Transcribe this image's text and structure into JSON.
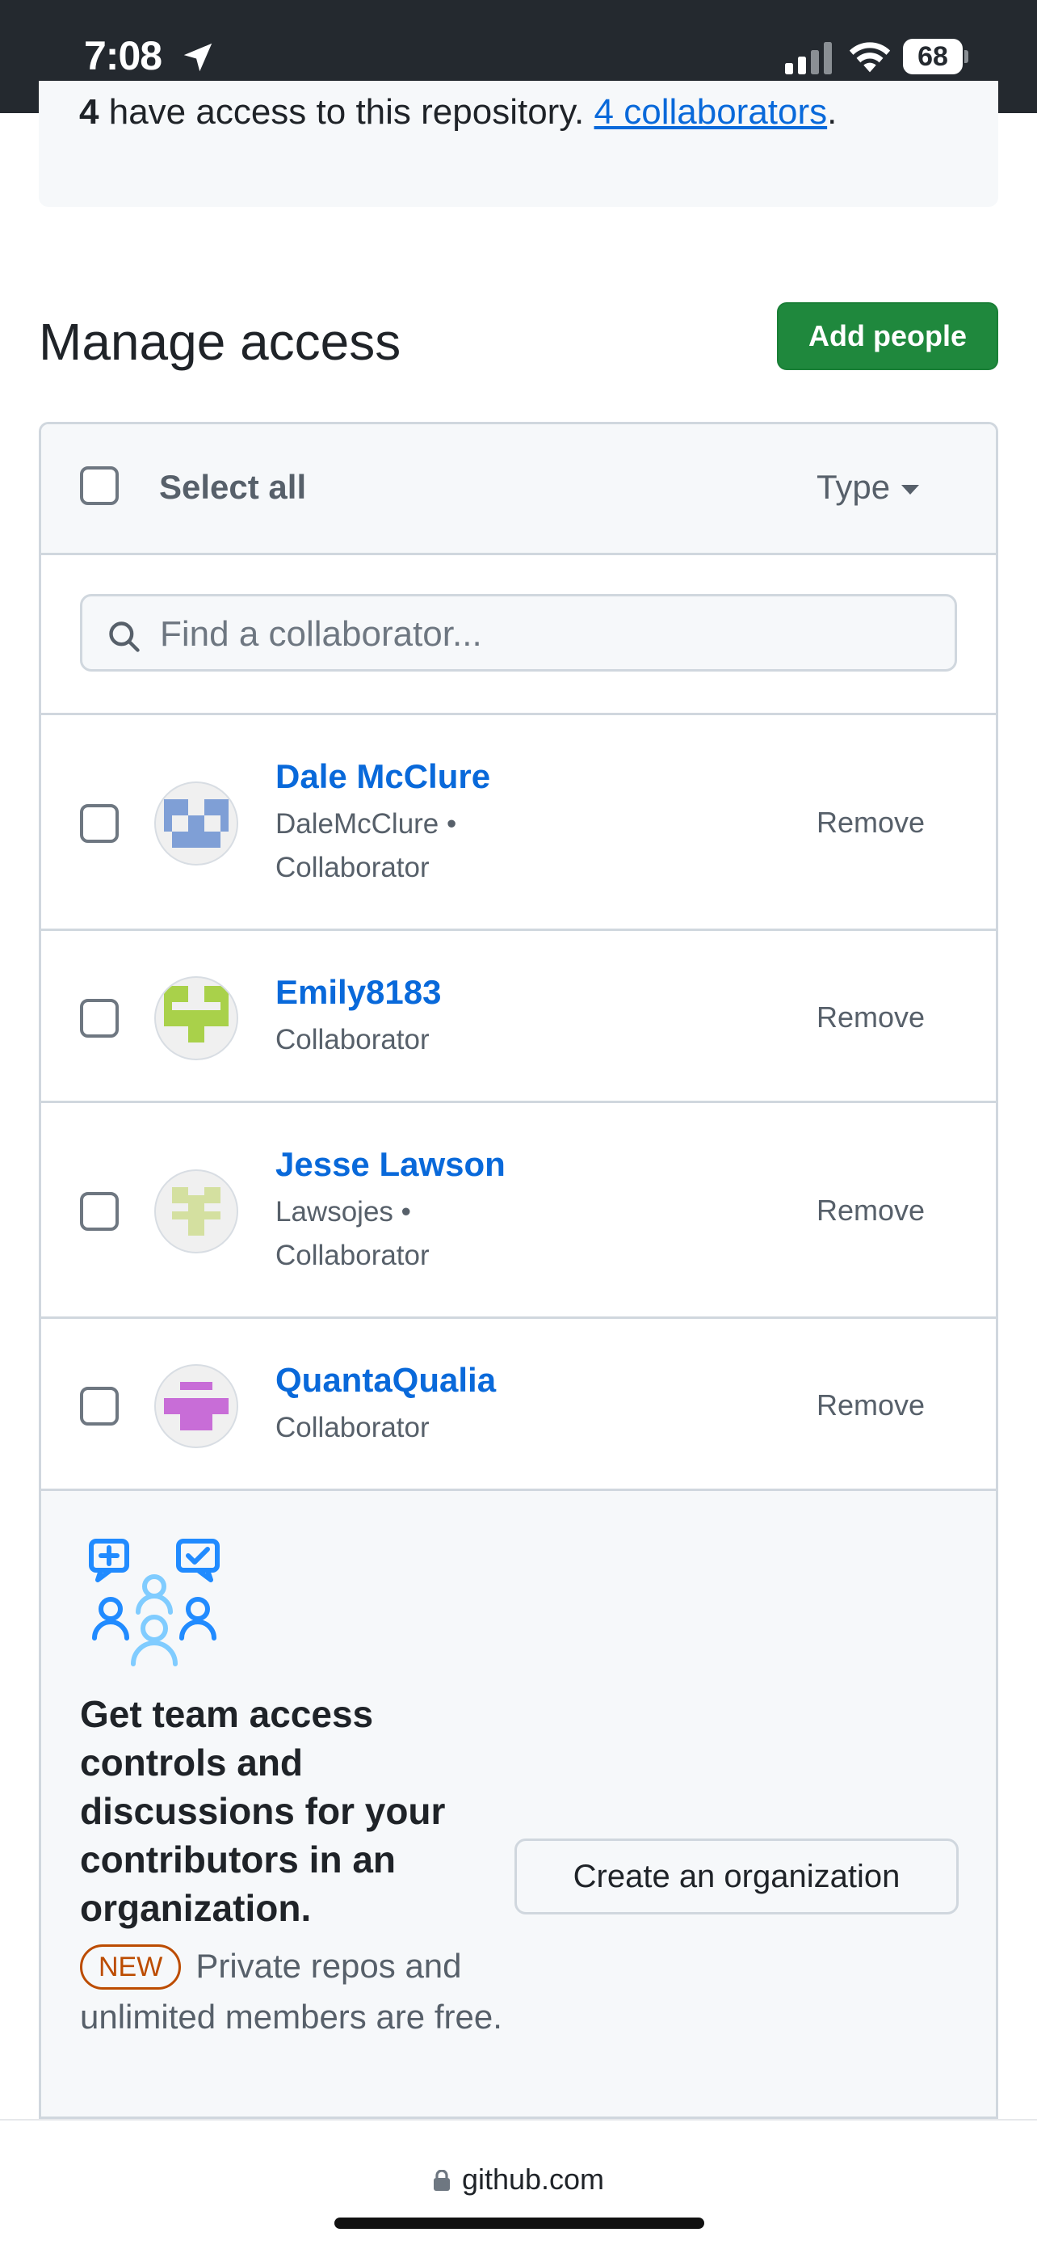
{
  "status_bar": {
    "time": "7:08",
    "battery": "68"
  },
  "access_info": {
    "count": "4",
    "text": "have access to this repository.",
    "link": "4 collaborators",
    "suffix": "."
  },
  "page": {
    "title": "Manage access",
    "add_button": "Add people"
  },
  "list": {
    "select_all": "Select all",
    "type_filter": "Type",
    "search_placeholder": "Find a collaborator..."
  },
  "collaborators": [
    {
      "name": "Dale McClure",
      "username": "DaleMcClure •",
      "role": "Collaborator",
      "remove": "Remove",
      "avatar_color": "#7f9fd6"
    },
    {
      "name": "Emily8183",
      "username": "",
      "role": "Collaborator",
      "remove": "Remove",
      "avatar_color": "#a9d14a"
    },
    {
      "name": "Jesse Lawson",
      "username": "Lawsojes •",
      "role": "Collaborator",
      "remove": "Remove",
      "avatar_color": "#d4e0a0"
    },
    {
      "name": "QuantaQualia",
      "username": "",
      "role": "Collaborator",
      "remove": "Remove",
      "avatar_color": "#c86dd7"
    }
  ],
  "promo": {
    "title": "Get team access controls and discussions for your contributors in an organization.",
    "badge": "NEW",
    "desc": "Private repos and unlimited members are free.",
    "button": "Create an organization"
  },
  "browser": {
    "url": "github.com"
  },
  "colors": {
    "accent_green": "#1f883d",
    "link_blue": "#0969da",
    "badge_orange": "#bc4c00"
  }
}
